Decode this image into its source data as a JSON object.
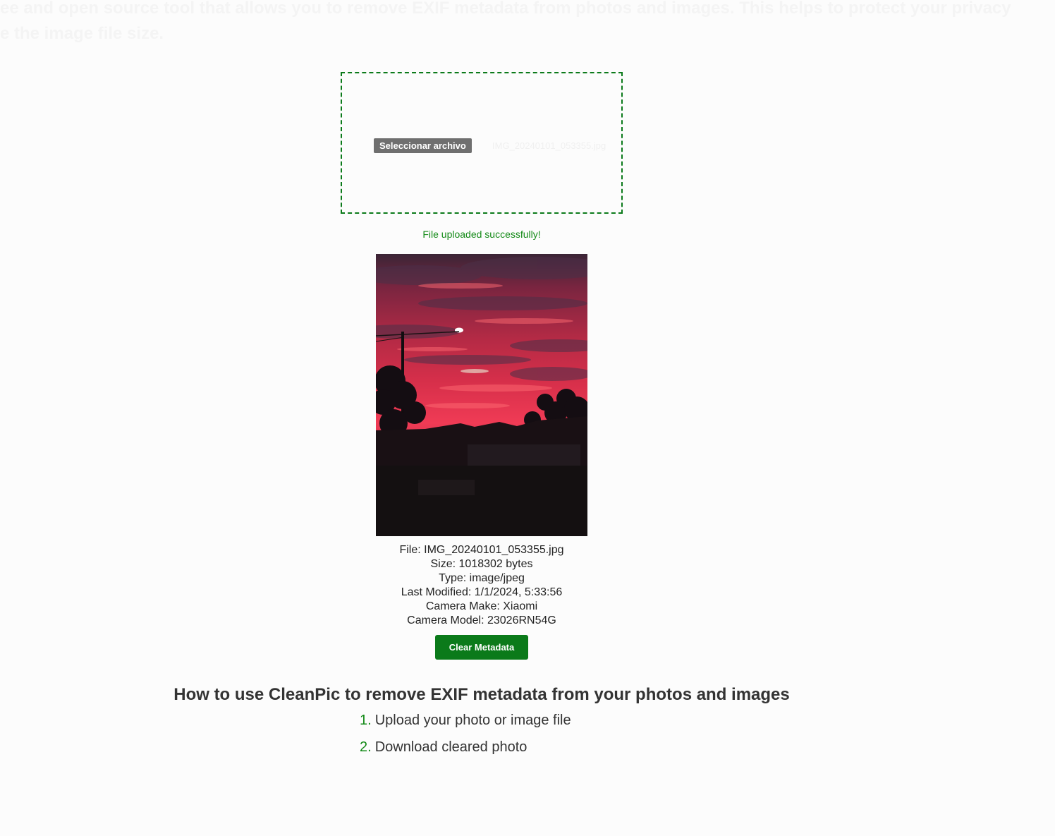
{
  "intro": {
    "line1": "ee and open source tool that allows you to remove EXIF metadata from photos and images. This helps to protect your privacy",
    "line2": "e the image file size."
  },
  "upload": {
    "button_label": "Seleccionar archivo",
    "file_name": "IMG_20240101_053355.jpg",
    "status": "File uploaded successfully!"
  },
  "metadata": {
    "file": "File: IMG_20240101_053355.jpg",
    "size": "Size: 1018302 bytes",
    "type": "Type: image/jpeg",
    "last_modified": "Last Modified: 1/1/2024, 5:33:56",
    "camera_make": "Camera Make: Xiaomi",
    "camera_model": "Camera Model: 23026RN54G"
  },
  "clear_button_label": "Clear Metadata",
  "howto": {
    "title": "How to use CleanPic to remove EXIF metadata from your photos and images",
    "steps": [
      {
        "num": "1.",
        "text": "Upload your photo or image file"
      },
      {
        "num": "2.",
        "text": "Download cleared photo"
      }
    ]
  },
  "colors": {
    "accent": "#0b7a1a",
    "status_text": "#138a17",
    "file_button": "#6f6f6f"
  }
}
